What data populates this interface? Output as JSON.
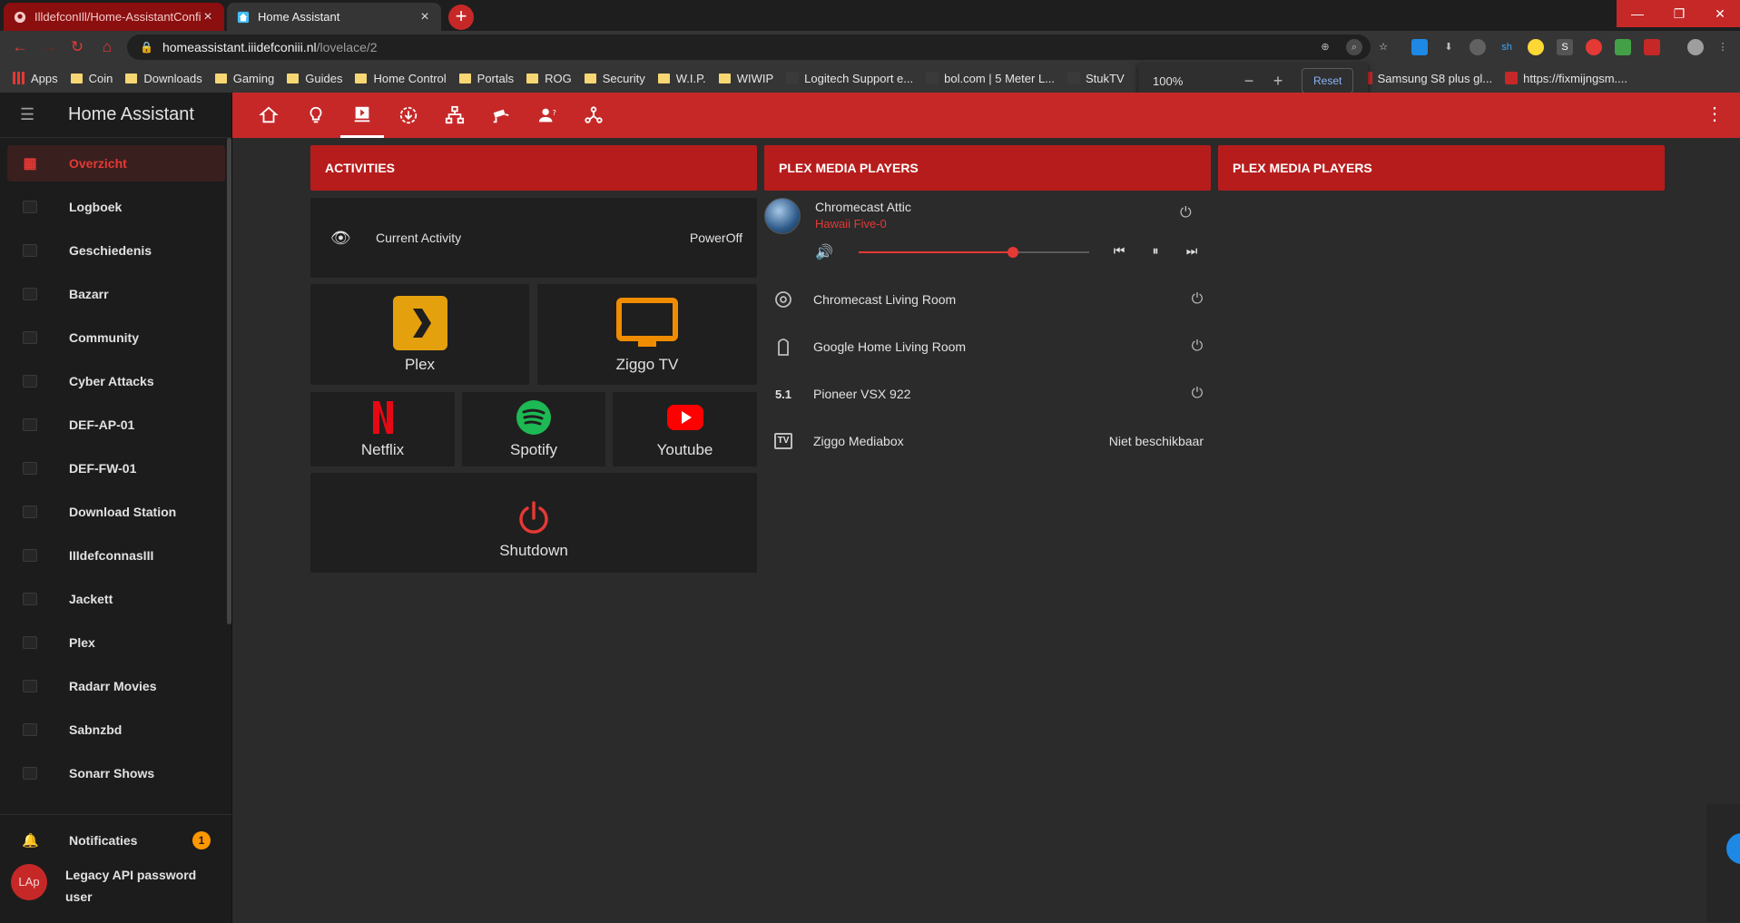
{
  "browser": {
    "tabs": [
      {
        "title": "IlldefconIll/Home-AssistantConfi",
        "icon": "github-icon"
      },
      {
        "title": "Home Assistant",
        "icon": "home-assistant-icon"
      }
    ],
    "url_host": "homeassistant.iiidefconiii.nl",
    "url_path": "/lovelace/2",
    "zoom": {
      "level": "100%",
      "minus": "−",
      "plus": "+",
      "reset": "Reset"
    },
    "bookmarks": [
      {
        "label": "Apps",
        "kind": "apps"
      },
      {
        "label": "Coin",
        "kind": "folder"
      },
      {
        "label": "Downloads",
        "kind": "folder"
      },
      {
        "label": "Gaming",
        "kind": "folder"
      },
      {
        "label": "Guides",
        "kind": "folder"
      },
      {
        "label": "Home Control",
        "kind": "folder"
      },
      {
        "label": "Portals",
        "kind": "folder"
      },
      {
        "label": "ROG",
        "kind": "folder"
      },
      {
        "label": "Security",
        "kind": "folder"
      },
      {
        "label": "W.I.P.",
        "kind": "folder"
      },
      {
        "label": "WIWIP",
        "kind": "folder"
      },
      {
        "label": "Logitech Support e...",
        "kind": "site"
      },
      {
        "label": "bol.com | 5 Meter L...",
        "kind": "site"
      },
      {
        "label": "StukTV",
        "kind": "site"
      }
    ],
    "bookmarks_right": [
      {
        "label": "Samsung S8 plus gl..."
      },
      {
        "label": "https://fixmijngsm...."
      }
    ]
  },
  "sidebar": {
    "title": "Home Assistant",
    "items": [
      {
        "label": "Overzicht",
        "name": "overzicht",
        "active": true
      },
      {
        "label": "Logboek",
        "name": "logboek"
      },
      {
        "label": "Geschiedenis",
        "name": "geschiedenis"
      },
      {
        "label": "Bazarr",
        "name": "bazarr"
      },
      {
        "label": "Community",
        "name": "community"
      },
      {
        "label": "Cyber Attacks",
        "name": "cyber-attacks"
      },
      {
        "label": "DEF-AP-01",
        "name": "def-ap-01"
      },
      {
        "label": "DEF-FW-01",
        "name": "def-fw-01"
      },
      {
        "label": "Download Station",
        "name": "download-station"
      },
      {
        "label": "IIIdefconnasIII",
        "name": "iiidefconnasiii"
      },
      {
        "label": "Jackett",
        "name": "jackett"
      },
      {
        "label": "Plex",
        "name": "plex"
      },
      {
        "label": "Radarr Movies",
        "name": "radarr-movies"
      },
      {
        "label": "Sabnzbd",
        "name": "sabnzbd"
      },
      {
        "label": "Sonarr Shows",
        "name": "sonarr-shows"
      }
    ],
    "notifications": {
      "label": "Notificaties",
      "count": "1"
    },
    "user": {
      "initials": "LAp",
      "name": "Legacy API password user"
    }
  },
  "header": {
    "tabs": [
      "home-icon",
      "lightbulb-icon",
      "media-icon",
      "download-icon",
      "network-icon",
      "cctv-icon",
      "person-icon",
      "molecule-icon"
    ],
    "active_tab": 2
  },
  "columns": {
    "activities": {
      "title": "ACTIVITIES",
      "current_activity_label": "Current Activity",
      "current_activity_value": "PowerOff",
      "buttons": {
        "plex": "Plex",
        "ziggo": "Ziggo TV",
        "netflix": "Netflix",
        "spotify": "Spotify",
        "youtube": "Youtube",
        "shutdown": "Shutdown"
      }
    },
    "plex1": {
      "title": "PLEX MEDIA PLAYERS",
      "playing": {
        "name": "Chromecast Attic",
        "media": "Hawaii Five-0",
        "volume": 0.67
      },
      "players": [
        {
          "name": "Chromecast Living Room",
          "icon": "chromecast-icon",
          "state": ""
        },
        {
          "name": "Google Home Living Room",
          "icon": "speaker-icon",
          "state": ""
        },
        {
          "name": "Pioneer VSX 922",
          "icon": "surround-5-1-icon",
          "state": "",
          "icon_text": "5.1"
        },
        {
          "name": "Ziggo Mediabox",
          "icon": "tv-box-icon",
          "state": "Niet beschikbaar",
          "icon_text": "TV"
        }
      ]
    },
    "plex2": {
      "title": "PLEX MEDIA PLAYERS"
    }
  },
  "colors": {
    "accent": "#c62828",
    "accent_dark": "#b71c1c",
    "plex": "#e5a00d",
    "netflix": "#e50914",
    "spotify": "#1db954",
    "youtube": "#ff0000"
  }
}
